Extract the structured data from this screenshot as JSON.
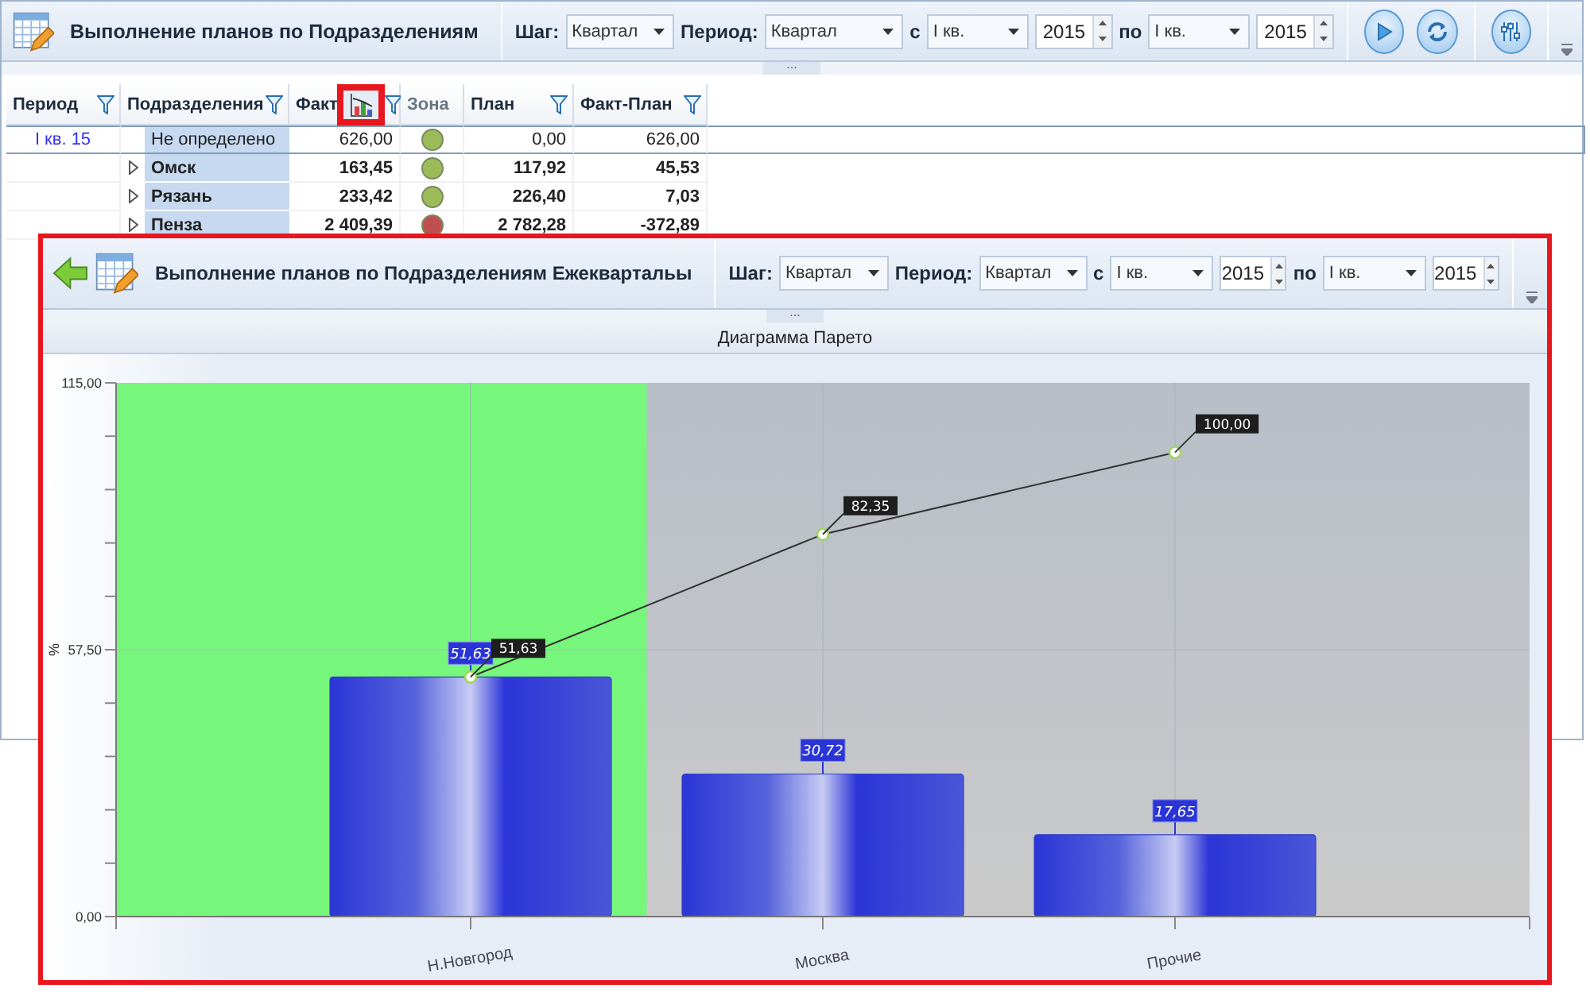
{
  "main_window": {
    "title": "Выполнение планов по Подразделениям",
    "toolbar": {
      "step_label": "Шаг:",
      "step_value": "Квартал",
      "period_label": "Период:",
      "period_value": "Квартал",
      "from_label": "с",
      "from_quarter": "I кв.",
      "from_year": "2015",
      "to_label": "по",
      "to_quarter": "I кв.",
      "to_year": "2015"
    },
    "splitter_grip": "...",
    "grid": {
      "columns": [
        {
          "label": "Период",
          "filter": true,
          "highlighted": false
        },
        {
          "label": "Подразделения",
          "filter": true,
          "highlighted": false
        },
        {
          "label": "Факт",
          "filter": true,
          "highlighted": true
        },
        {
          "label": "Зона",
          "filter": false,
          "highlighted": false
        },
        {
          "label": "План",
          "filter": true,
          "highlighted": false
        },
        {
          "label": "Факт-План",
          "filter": true,
          "highlighted": false
        }
      ],
      "rows": [
        {
          "period": "I кв. 15",
          "unit": "Не определено",
          "expandable": false,
          "fact": "626,00",
          "color": "#9bbb59",
          "plan": "0,00",
          "diff": "626,00",
          "selected": true
        },
        {
          "unit": "Омск",
          "expandable": true,
          "fact": "163,45",
          "color": "#9bbb59",
          "plan": "117,92",
          "diff": "45,53",
          "selected": false
        },
        {
          "unit": "Рязань",
          "expandable": true,
          "fact": "233,42",
          "color": "#9bbb59",
          "plan": "226,40",
          "diff": "7,03",
          "selected": false
        },
        {
          "unit": "Пенза",
          "expandable": true,
          "fact": "2 409,39",
          "color": "#c0504d",
          "plan": "2 782,28",
          "diff": "-372,89",
          "selected": false
        }
      ]
    }
  },
  "popup": {
    "title": "Выполнение планов по Подразделениям Ежеквартальы",
    "highlighted": true,
    "toolbar": {
      "step_label": "Шаг:",
      "step_value": "Квартал",
      "period_label": "Период:",
      "period_value": "Квартал",
      "from_label": "с",
      "from_quarter": "I кв.",
      "from_year": "2015",
      "to_label": "по",
      "to_quarter": "I кв.",
      "to_year": "2015"
    },
    "splitter_grip": "...",
    "chart_data": {
      "type": "bar",
      "title": "Диаграмма Парето",
      "ylabel": "%",
      "categories": [
        "Н.Новгород",
        "Москва",
        "Прочие"
      ],
      "series": [
        {
          "type": "bar",
          "color": "#2b35d6",
          "values": [
            51.63,
            30.72,
            17.65
          ],
          "value_labels": [
            "51,63",
            "30,72",
            "17,65"
          ]
        },
        {
          "type": "line",
          "color": "#333333",
          "marker": "o",
          "values": [
            51.63,
            82.35,
            100
          ],
          "value_labels": [
            "51,63",
            "82,35",
            "100,00"
          ]
        }
      ],
      "grid": true,
      "ref_lines": [
        {
          "axis": "y",
          "value": 57.5
        }
      ],
      "ylim": [
        0,
        115
      ],
      "yticks": [
        {
          "value": 0,
          "label": "0,00"
        },
        {
          "value": 57.5,
          "label": "57,50"
        },
        {
          "value": 115,
          "label": "115,00"
        }
      ],
      "data_labels": true
    }
  }
}
